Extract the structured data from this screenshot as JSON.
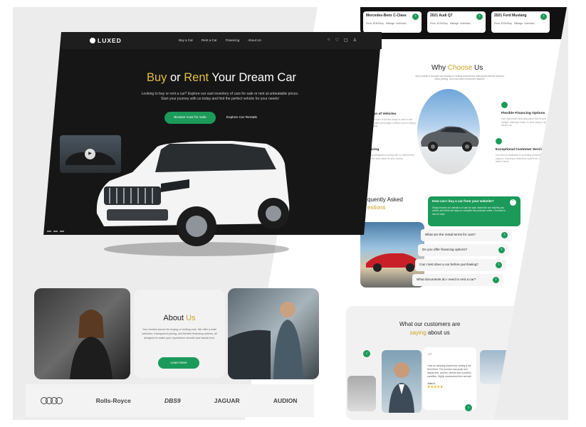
{
  "car_cards": [
    {
      "name": "Mercedes-Benz C-Class",
      "price": "Price: $180/Day",
      "mileage": "Mileage: Unlimited"
    },
    {
      "name": "2021 Audi Q7",
      "price": "Price: $190/Day",
      "mileage": "Mileage: Unlimited"
    },
    {
      "name": "2021 Ford Mustang",
      "price": "Price: $200/Day",
      "mileage": "Mileage: Unlimited"
    }
  ],
  "hero": {
    "logo": "LUXED",
    "nav": [
      "Buy a Car",
      "Rent a Car",
      "Financing",
      "About Us"
    ],
    "title_buy": "Buy",
    "title_or": " or ",
    "title_rent": "Rent",
    "title_rest": " Your Dream Car",
    "description": "Looking to buy or rent a car? Explore our vast inventory of cars for sale or rent at unbeatable prices. Start your journey with us today and find the perfect vehicle for your needs!",
    "primary_cta": "Browse Cars for Sale",
    "secondary_cta": "Explore Car Rentals"
  },
  "why": {
    "title_a": "Why ",
    "title_b": "Choose",
    "title_c": " Us",
    "subtitle": "We provide a smooth car buying or renting experience with great vehicle options, easy pricing, and top-notch customer support.",
    "features": [
      {
        "title": "Wide Selection of Vehicles",
        "desc": "Choose from a diverse range of cars to suit every taste and budget, whether you're buying or renting."
      },
      {
        "title": "Competitive Pricing",
        "desc": "Enjoy transparent pricing with no hidden fees. Get the best value for your money."
      },
      {
        "title": "Flexible Financing Options",
        "desc": "Get customized financing plans that fit your budget, making it easier to drive away in your dream car."
      },
      {
        "title": "Exceptional Customer Service",
        "desc": "Our team is dedicated to providing personalized support, ensuring a seamless experience from start to finish."
      }
    ],
    "feature_labels_visible": [
      "ection of Vehicles",
      "Pricing",
      "Flexible Financing Options",
      "Exceptional Customer Service"
    ]
  },
  "faq": {
    "title_a": "Frequently Asked",
    "title_b": "Questions",
    "title_visible_a": "quently Asked",
    "title_visible_b": "estions",
    "active_q": "How can I buy a car from your website?",
    "active_a": "Simply browse our selection of cars for sale, select the one that fits your needs, and follow the steps to complete the purchase online. Our team is here to help!",
    "items": [
      "What are the rental terms for cars?",
      "Do you offer financing options?",
      "Can I test drive a car before purchasing?",
      "What documents do I need to rent a car?"
    ]
  },
  "reviews": {
    "title_a": "What our customers are",
    "title_b": "saying",
    "title_c": " about us",
    "quote": "I had an amazing experience renting a car from them. The process was quick and hassle-free, and the vehicle was in perfect condition. Highly recommend their service!",
    "name": "John D.",
    "stars": "★★★★★"
  },
  "about": {
    "title_a": "About ",
    "title_b": "Us",
    "desc": "Your trusted source for buying or renting cars. We offer a wide selection, transparent pricing, and flexible financing options, all designed to make your experience smooth and hassle-free.",
    "button": "Learn More"
  },
  "brands": [
    "Rolls-Royce",
    "DBS9",
    "JAGUAR",
    "AUDION"
  ],
  "colors": {
    "accent_green": "#1c9a5a",
    "accent_gold": "#c9a227",
    "hero_bg": "#161616"
  }
}
